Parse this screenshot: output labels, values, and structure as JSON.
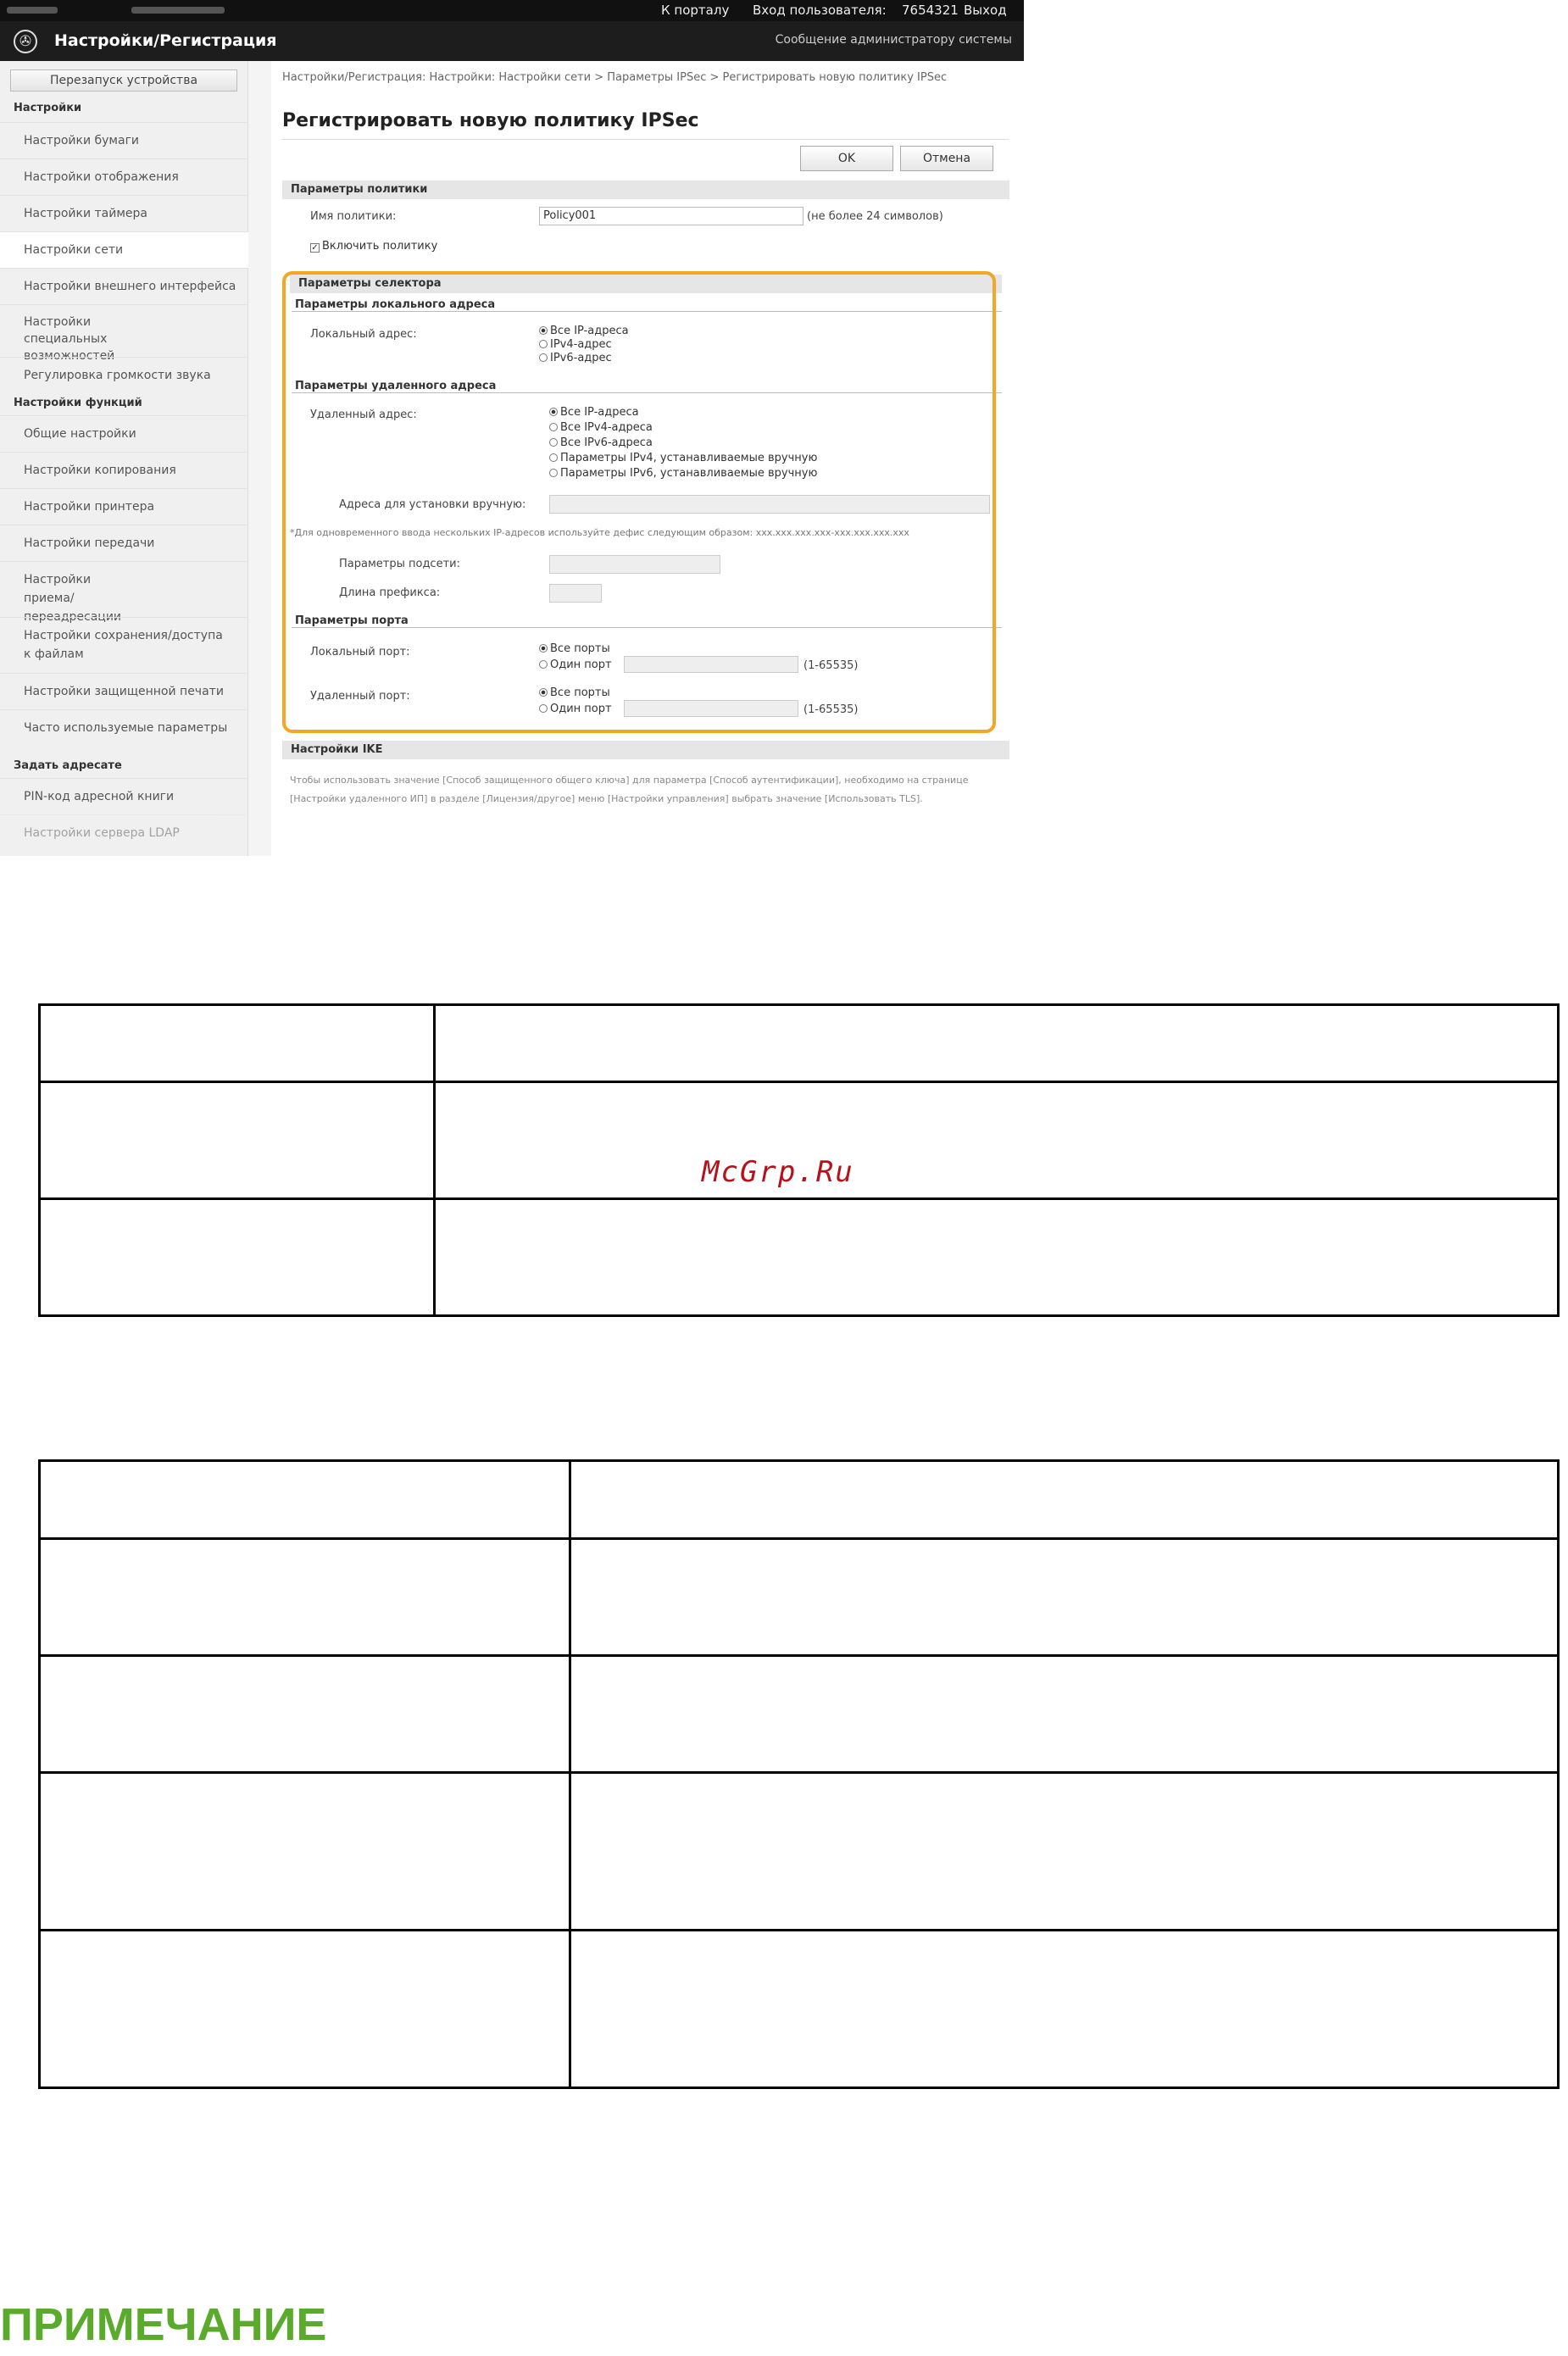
{
  "topbar": {
    "portal": "К порталу",
    "login_label": "Вход пользователя:",
    "user_id": "7654321",
    "logout": "Выход"
  },
  "header": {
    "logo_glyph": "✇",
    "title": "Настройки/Регистрация",
    "admin_message": "Сообщение администратору системы"
  },
  "sidebar": {
    "reboot": "Перезапуск устройства",
    "cat_settings": "Настройки",
    "items": [
      "Настройки бумаги",
      "Настройки отображения",
      "Настройки таймера",
      "Настройки сети",
      "Настройки внешнего интерфейса",
      "Настройки специальных возможностей",
      "Регулировка громкости звука"
    ],
    "cat_functions": "Настройки функций",
    "func_items": [
      "Общие настройки",
      "Настройки копирования",
      "Настройки принтера",
      "Настройки передачи",
      "Настройки приема/переадресации",
      "Настройки сохранения/доступа к файлам",
      "Настройки защищенной печати",
      "Часто используемые параметры"
    ],
    "cat_address": "Задать адресате",
    "addr_items": [
      "PIN-код адресной книги",
      "Настройки сервера LDAP"
    ]
  },
  "main": {
    "breadcrumb": "Настройки/Регистрация: Настройки: Настройки сети > Параметры IPSec > Регистрировать новую политику IPSec",
    "title": "Регистрировать новую политику IPSec",
    "ok": "OK",
    "cancel": "Отмена",
    "policy_section": "Параметры политики",
    "policy_name_label": "Имя политики:",
    "policy_name_value": "Policy001",
    "policy_name_hint": "(не более 24 символов)",
    "enable_policy": "Включить политику",
    "selector_section": "Параметры селектора",
    "local_addr_head": "Параметры локального адреса",
    "local_addr_label": "Локальный адрес:",
    "local_opts": [
      "Все IP-адреса",
      "IPv4-адрес",
      "IPv6-адрес"
    ],
    "remote_addr_head": "Параметры удаленного адреса",
    "remote_addr_label": "Удаленный адрес:",
    "remote_opts": [
      "Все IP-адреса",
      "Все IPv4-адреса",
      "Все IPv6-адреса",
      "Параметры IPv4, устанавливаемые вручную",
      "Параметры IPv6, устанавливаемые вручную"
    ],
    "manual_addr_label": "Адреса для установки вручную:",
    "manual_hint": "*Для одновременного ввода нескольких IP-адресов используйте дефис следующим образом: xxx.xxx.xxx.xxx-xxx.xxx.xxx.xxx",
    "subnet_label": "Параметры подсети:",
    "prefix_label": "Длина префикса:",
    "port_head": "Параметры порта",
    "local_port_label": "Локальный порт:",
    "remote_port_label": "Удаленный порт:",
    "all_ports": "Все порты",
    "one_port": "Один порт",
    "port_range": "(1-65535)",
    "ike_section": "Настройки IKE",
    "ike_text": "Чтобы использовать значение [Способ защищенного общего ключа] для параметра [Способ аутентификации], необходимо на странице [Настройки удаленного ИП] в разделе [Лицензия/другое] меню [Настройки управления] выбрать значение [Использовать TLS]."
  },
  "watermark": "McGrp.Ru",
  "note_heading": "ПРИМЕЧАНИЕ"
}
